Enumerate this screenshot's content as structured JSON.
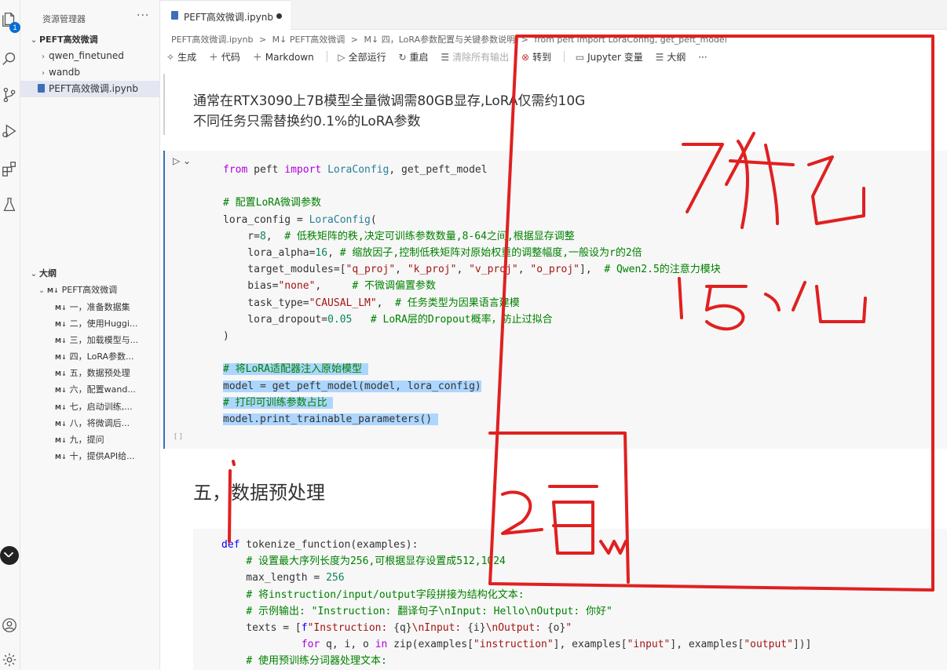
{
  "sidebar": {
    "title": "资源管理器",
    "more": "···",
    "folder": "PEFT高效微调",
    "items": [
      "qwen_finetuned",
      "wandb",
      "PEFT高效微调.ipynb"
    ],
    "outline_title": "大纲",
    "outline_root": "PEFT高效微调",
    "md_badge": "M↓",
    "outline": [
      "一，准备数据集",
      "二，使用Huggi...",
      "三，加载模型与...",
      "四，LoRA参数...",
      "五，数据预处理",
      "六，配置wand...",
      "七，启动训练,...",
      "八，将微调后...",
      "九，提问",
      "十，提供API给..."
    ],
    "badge_count": "1"
  },
  "tab": {
    "label": "PEFT高效微调.ipynb"
  },
  "breadcrumbs": [
    "PEFT高效微调.ipynb",
    ">",
    "M↓ PEFT高效微调",
    ">",
    "M↓ 四，LoRA参数配置与关键参数说明",
    ">",
    "from peft import LoraConfig, get_peft_model"
  ],
  "toolbar": {
    "generate": "生成",
    "code": "代码",
    "markdown": "Markdown",
    "run_all": "全部运行",
    "restart": "重启",
    "clear": "清除所有输出",
    "goto": "转到",
    "vars": "Jupyter 变量",
    "outline": "大纲",
    "more": "···"
  },
  "markdown_cell": {
    "line1": "通常在RTX3090上7B模型全量微调需80GB显存,LoRA仅需约10G",
    "line2": "不同任务只需替换约0.1%的LoRA参数"
  },
  "code_cell": {
    "exec_count": "[ ]"
  },
  "heading": "五，数据预处理",
  "annotations": {
    "handwriting": [
      "70亿",
      "15亿",
      "2百w"
    ],
    "ink_color": "#e02020"
  }
}
